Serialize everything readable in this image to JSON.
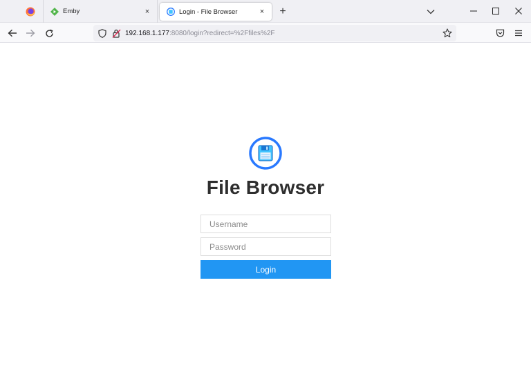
{
  "browser": {
    "tabs": [
      {
        "title": "Emby",
        "icon": "emby-icon",
        "active": false
      },
      {
        "title": "Login - File Browser",
        "icon": "filebrowser-favicon",
        "active": true
      }
    ],
    "close_glyph": "×",
    "new_tab_glyph": "+",
    "url": {
      "host": "192.168.1.177",
      "rest": ":8080/login?redirect=%2Ffiles%2F"
    }
  },
  "app": {
    "title": "File Browser",
    "logo": "floppy-disk-logo",
    "accent_color": "#2196f3"
  },
  "form": {
    "username_placeholder": "Username",
    "password_placeholder": "Password",
    "login_label": "Login"
  }
}
